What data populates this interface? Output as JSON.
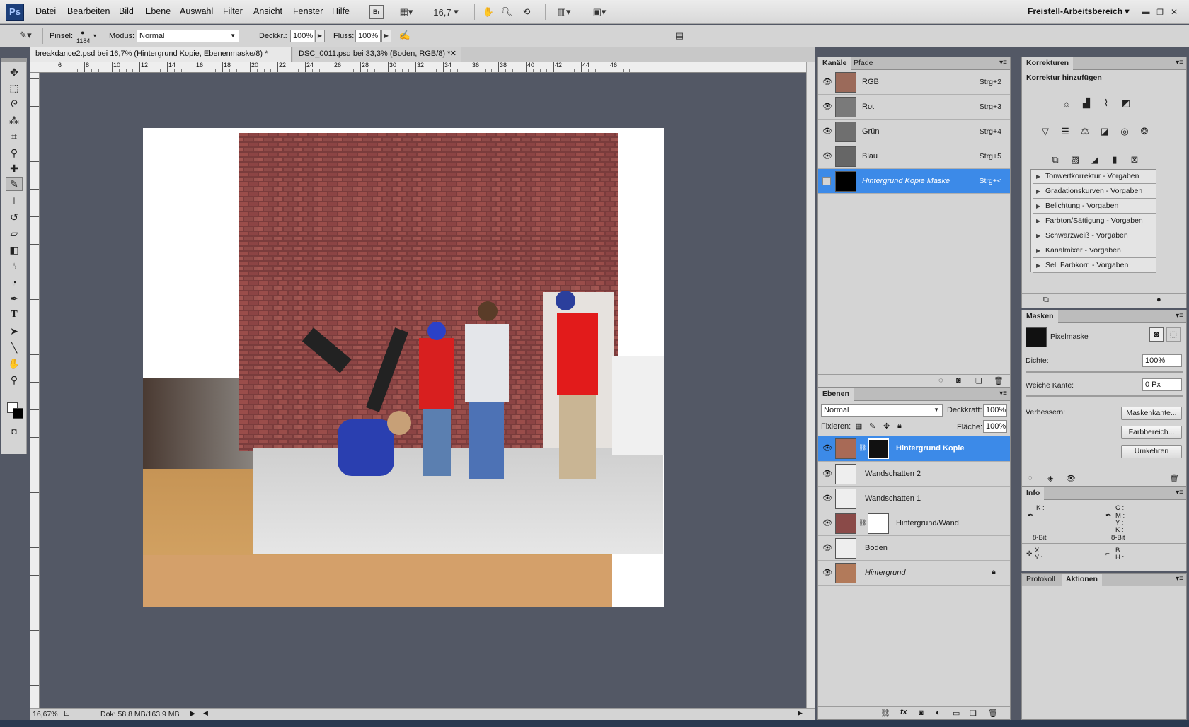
{
  "app": {
    "logo": "Ps"
  },
  "menu": [
    "Datei",
    "Bearbeiten",
    "Bild",
    "Ebene",
    "Auswahl",
    "Filter",
    "Ansicht",
    "Fenster",
    "Hilfe"
  ],
  "appbar": {
    "bridge_label": "Br",
    "zoom_value": "16,7",
    "workspace": "Freistell-Arbeitsbereich"
  },
  "options": {
    "brush_label": "Pinsel:",
    "brush_size": "1184",
    "mode_label": "Modus:",
    "mode_value": "Normal",
    "opacity_label": "Deckkr.:",
    "opacity_value": "100%",
    "flow_label": "Fluss:",
    "flow_value": "100%"
  },
  "doc_tabs": [
    {
      "label": "breakdance2.psd bei 16,7% (Hintergrund Kopie, Ebenenmaske/8) *",
      "active": true
    },
    {
      "label": "DSC_0011.psd bei 33,3% (Boden, RGB/8) *",
      "active": false
    }
  ],
  "ruler_h": [
    "6",
    "8",
    "10",
    "12",
    "14",
    "16",
    "18",
    "20",
    "22",
    "24",
    "26",
    "28",
    "30",
    "32",
    "34",
    "36",
    "38",
    "40",
    "42",
    "44",
    "46"
  ],
  "status": {
    "zoom": "16,67%",
    "doc": "Dok: 58,8 MB/163,9 MB"
  },
  "channels": {
    "tabs": [
      "Kanäle",
      "Pfade"
    ],
    "rows": [
      {
        "name": "RGB",
        "shortcut": "Strg+2"
      },
      {
        "name": "Rot",
        "shortcut": "Strg+3"
      },
      {
        "name": "Grün",
        "shortcut": "Strg+4"
      },
      {
        "name": "Blau",
        "shortcut": "Strg+5"
      },
      {
        "name": "Hintergrund Kopie Maske",
        "shortcut": "Strg+<"
      }
    ]
  },
  "layers": {
    "tab": "Ebenen",
    "blend_mode": "Normal",
    "opacity_label": "Deckkraft:",
    "opacity_value": "100%",
    "lock_label": "Fixieren:",
    "fill_label": "Fläche:",
    "fill_value": "100%",
    "rows": [
      {
        "name": "Hintergrund Kopie"
      },
      {
        "name": "Wandschatten 2"
      },
      {
        "name": "Wandschatten 1"
      },
      {
        "name": "Hintergrund/Wand"
      },
      {
        "name": "Boden"
      },
      {
        "name": "Hintergrund"
      }
    ]
  },
  "adjustments": {
    "tab": "Korrekturen",
    "title": "Korrektur hinzufügen",
    "presets": [
      "Tonwertkorrektur - Vorgaben",
      "Gradationskurven - Vorgaben",
      "Belichtung - Vorgaben",
      "Farbton/Sättigung - Vorgaben",
      "Schwarzweiß - Vorgaben",
      "Kanalmixer - Vorgaben",
      "Sel. Farbkorr. - Vorgaben"
    ]
  },
  "masks": {
    "tab": "Masken",
    "type": "Pixelmaske",
    "density_label": "Dichte:",
    "density_value": "100%",
    "feather_label": "Weiche Kante:",
    "feather_value": "0 Px",
    "refine_label": "Verbessern:",
    "btn_edge": "Maskenkante...",
    "btn_color": "Farbbereich...",
    "btn_invert": "Umkehren"
  },
  "info": {
    "tab": "Info",
    "k_label": "K :",
    "c_label": "C :",
    "m_label": "M :",
    "y_label": "Y :",
    "k2_label": "K :",
    "bit_left": "8-Bit",
    "bit_right": "8-Bit",
    "x_label": "X :",
    "y2_label": "Y :",
    "b_label": "B :",
    "h_label": "H :"
  },
  "bottom_tabs": [
    "Protokoll",
    "Aktionen"
  ]
}
